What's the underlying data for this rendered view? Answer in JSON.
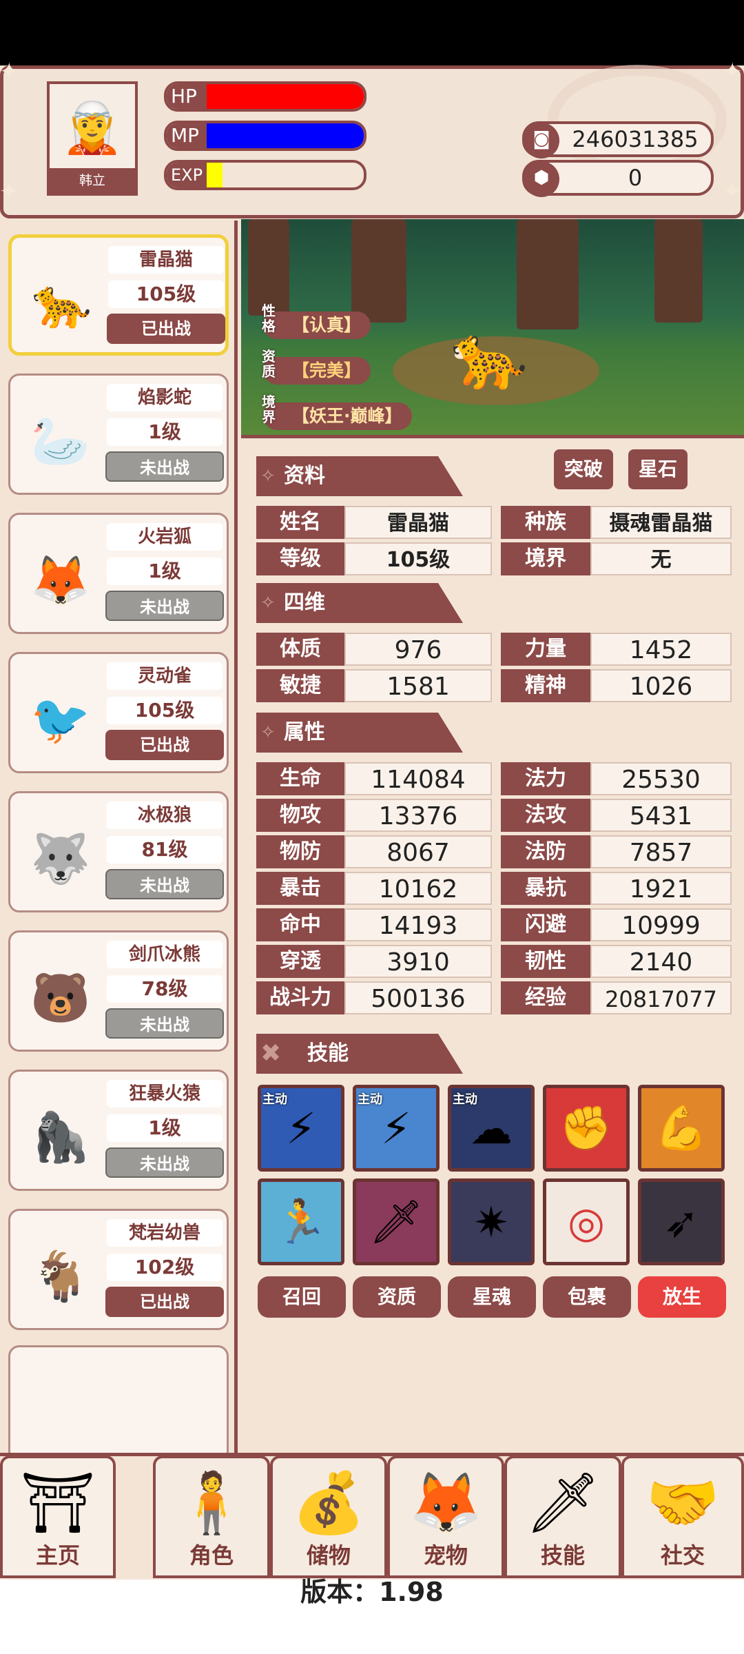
{
  "player": {
    "name": "韩立",
    "hp_label": "HP",
    "mp_label": "MP",
    "exp_label": "EXP",
    "hp": 1.0,
    "mp": 1.0,
    "exp": 0.1
  },
  "currency": {
    "coins": "246031385",
    "gems": "0"
  },
  "pets": [
    {
      "name": "雷晶猫",
      "level": "105级",
      "status": "已出战",
      "icon": "panther-icon",
      "selected": true
    },
    {
      "name": "焰影蛇",
      "level": "1级",
      "status": "未出战",
      "icon": "snake-icon"
    },
    {
      "name": "火岩狐",
      "level": "1级",
      "status": "未出战",
      "icon": "fox-icon"
    },
    {
      "name": "灵动雀",
      "level": "105级",
      "status": "已出战",
      "icon": "bird-icon"
    },
    {
      "name": "冰极狼",
      "level": "81级",
      "status": "未出战",
      "icon": "wolf-icon"
    },
    {
      "name": "剑爪冰熊",
      "level": "78级",
      "status": "未出战",
      "icon": "bear-icon"
    },
    {
      "name": "狂暴火猿",
      "level": "1级",
      "status": "未出战",
      "icon": "ape-icon"
    },
    {
      "name": "梵岩幼兽",
      "level": "102级",
      "status": "已出战",
      "icon": "beast-icon"
    }
  ],
  "traits": {
    "personality_key": "性格",
    "personality": "【认真】",
    "aptitude_key": "资质",
    "aptitude": "【完美】",
    "realm_key": "境界",
    "realm": "【妖王·巅峰】"
  },
  "sections": {
    "info": "资料",
    "four": "四维",
    "attr": "属性",
    "skills": "技能",
    "breakthrough": "突破",
    "starstone": "星石"
  },
  "profile": [
    [
      "姓名",
      "雷晶猫",
      "种族",
      "摄魂雷晶猫"
    ],
    [
      "等级",
      "105级",
      "境界",
      "无"
    ]
  ],
  "fourdim": [
    [
      "体质",
      "976",
      "力量",
      "1452"
    ],
    [
      "敏捷",
      "1581",
      "精神",
      "1026"
    ]
  ],
  "attributes": [
    [
      "生命",
      "114084",
      "法力",
      "25530"
    ],
    [
      "物攻",
      "13376",
      "法攻",
      "5431"
    ],
    [
      "物防",
      "8067",
      "法防",
      "7857"
    ],
    [
      "暴击",
      "10162",
      "暴抗",
      "1921"
    ],
    [
      "命中",
      "14193",
      "闪避",
      "10999"
    ],
    [
      "穿透",
      "3910",
      "韧性",
      "2140"
    ],
    [
      "战斗力",
      "500136",
      "经验",
      "20817077"
    ]
  ],
  "skills": [
    {
      "icon": "lightning-cat-skill-icon",
      "tag": "主动"
    },
    {
      "icon": "thunder-cat-skill-icon",
      "tag": "主动"
    },
    {
      "icon": "storm-cat-skill-icon",
      "tag": "主动"
    },
    {
      "icon": "fist-skill-icon",
      "tag": ""
    },
    {
      "icon": "muscle-skill-icon",
      "tag": ""
    },
    {
      "icon": "speed-skill-icon",
      "tag": ""
    },
    {
      "icon": "slash-skill-icon",
      "tag": ""
    },
    {
      "icon": "crack-skill-icon",
      "tag": ""
    },
    {
      "icon": "target-skill-icon",
      "tag": ""
    },
    {
      "icon": "dash-skill-icon",
      "tag": ""
    }
  ],
  "actions": [
    "召回",
    "资质",
    "星魂",
    "包裹",
    "放生"
  ],
  "nav": [
    {
      "label": "主页",
      "icon": "home-gate-icon"
    },
    {
      "label": "角色",
      "icon": "character-icon"
    },
    {
      "label": "储物",
      "icon": "bag-icon"
    },
    {
      "label": "宠物",
      "icon": "pet-fox-icon"
    },
    {
      "label": "技能",
      "icon": "sword-icon"
    },
    {
      "label": "社交",
      "icon": "handshake-icon"
    }
  ],
  "version": "版本：1.98",
  "colors": {
    "primary": "#8c4a48",
    "hp": "#ff0000",
    "mp": "#0000ff",
    "exp": "#ffff00",
    "release": "#e8413f",
    "selected": "#f2cf3c"
  }
}
